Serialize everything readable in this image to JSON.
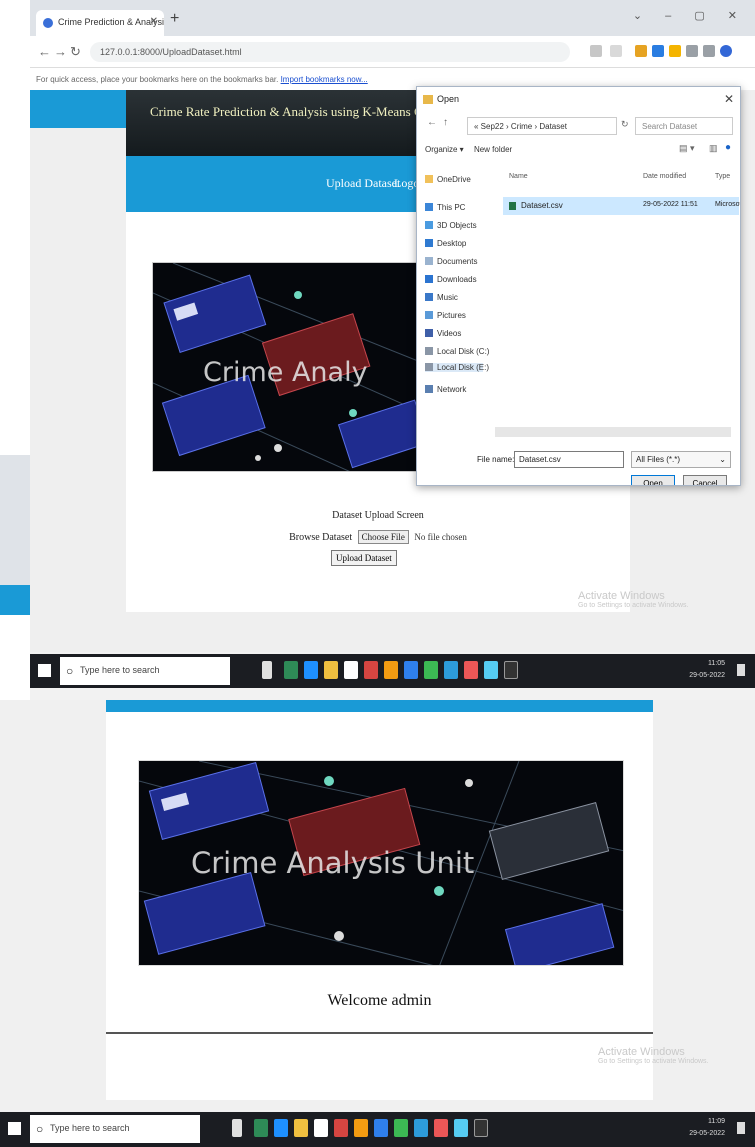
{
  "browser": {
    "tab_title": "Crime Prediction & Analysis",
    "url": "127.0.0.1:8000/UploadDataset.html",
    "bookmarks_text": "For quick access, place your bookmarks here on the bookmarks bar.",
    "bookmarks_link": "Import bookmarks now..."
  },
  "app": {
    "title": "Crime Rate Prediction & Analysis using K-Means Clustering Algo",
    "nav": [
      "Upload Dataset",
      "Logo"
    ]
  },
  "banner": {
    "text_top": "Crime Analy",
    "text_bottom": "Crime Analysis Unit"
  },
  "upload": {
    "screen_label": "Dataset Upload Screen",
    "browse_label": "Browse Dataset",
    "choose_file": "Choose File",
    "no_file": "No file chosen",
    "upload_button": "Upload Dataset"
  },
  "dialog": {
    "title": "Open",
    "path": "« Sep22 › Crime › Dataset",
    "search_placeholder": "Search Dataset",
    "organize": "Organize ▾",
    "new_folder": "New folder",
    "sidebar": [
      "OneDrive",
      "This PC",
      "3D Objects",
      "Desktop",
      "Documents",
      "Downloads",
      "Music",
      "Pictures",
      "Videos",
      "Local Disk (C:)",
      "Local Disk (E:)",
      "Network"
    ],
    "columns": {
      "name": "Name",
      "date": "Date modified",
      "type": "Type"
    },
    "file": {
      "name": "Dataset.csv",
      "date": "29-05-2022 11:51",
      "type": "Microsoft"
    },
    "file_name_label": "File name:",
    "file_name_value": "Dataset.csv",
    "file_type": "All Files (*.*)",
    "open_button": "Open",
    "cancel_button": "Cancel"
  },
  "watermark": {
    "title": "Activate Windows",
    "subtitle": "Go to Settings to activate Windows."
  },
  "taskbar": {
    "search_placeholder": "Type here to search",
    "time_top": "11:05",
    "date_top": "29-05-2022",
    "time_bottom": "11:09",
    "date_bottom": "29-05-2022"
  },
  "dashboard": {
    "welcome": "Welcome admin"
  },
  "colors": {
    "accent_blue": "#1a9ad6",
    "header_dark": "#1d2326",
    "dialog_selection": "#cce8ff"
  }
}
